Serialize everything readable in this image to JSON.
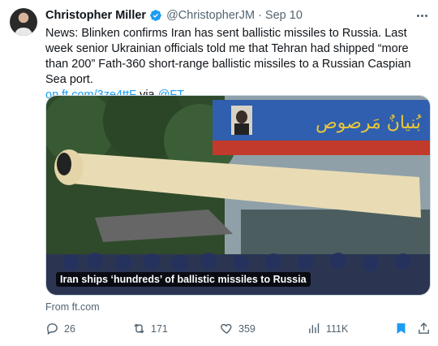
{
  "tweet": {
    "author_name": "Christopher Miller",
    "handle": "@ChristopherJM",
    "date": "Sep 10",
    "text_main": "News: Blinken confirms Iran has sent ballistic missiles to Russia. Last week senior Ukrainian officials told me that Tehran had shipped “more than 200” Fath-360 short-range ballistic missiles to a Russian Caspian Sea port.",
    "link_text": "on.ft.com/3ze4ttF",
    "via_text": "via",
    "via_mention": "@FT"
  },
  "card": {
    "image_caption": "Iran ships ‘hundreds’ of ballistic missiles to Russia",
    "banner_text": "بُنیانٌ مَرصوص",
    "source_label": "From ft.com"
  },
  "actions": {
    "replies": "26",
    "reposts": "171",
    "likes": "359",
    "views": "111K"
  },
  "colors": {
    "accent": "#1d9bf0",
    "secondary_text": "#536471"
  }
}
